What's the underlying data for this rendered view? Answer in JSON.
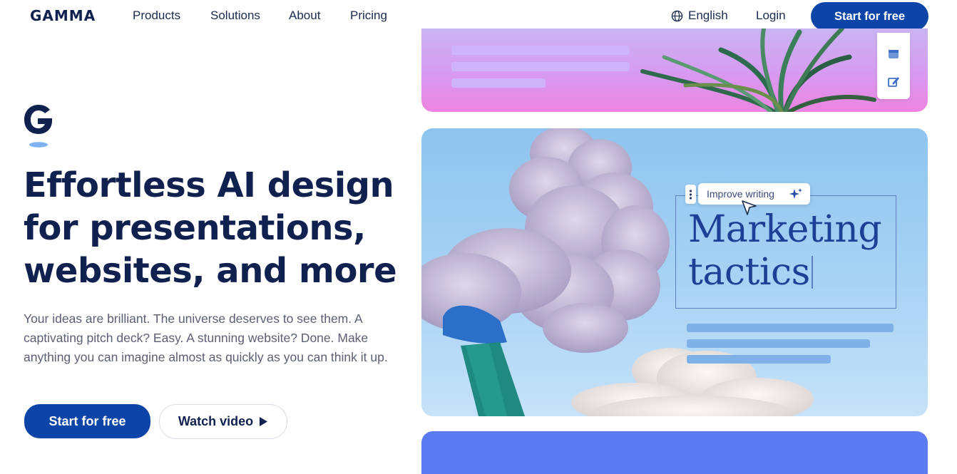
{
  "header": {
    "logo": "GAMMA",
    "nav": [
      "Products",
      "Solutions",
      "About",
      "Pricing"
    ],
    "language": "English",
    "login": "Login",
    "cta": "Start for free"
  },
  "hero": {
    "title_lines": [
      "Effortless AI design",
      "for presentations,",
      "websites, and more"
    ],
    "subtitle": "Your ideas are brilliant. The universe deserves to see them. A captivating pitch deck? Easy. A stunning website? Done. Make anything you can imagine almost as quickly as you can think it up.",
    "primary_cta": "Start for free",
    "secondary_cta": "Watch video"
  },
  "preview": {
    "ai_action": "Improve writing",
    "heading_lines": [
      "Marketing",
      "tactics"
    ]
  },
  "icons": [
    "globe-icon",
    "play-icon",
    "sparkle-icon",
    "cursor-icon",
    "card-layout-icon",
    "edit-icon",
    "drag-handle-icon"
  ],
  "colors": {
    "brand_navy": "#10214f",
    "primary_button": "#0d44a8",
    "card_pink": "#ec84e0",
    "card_blue": "#8ec4ef",
    "card_bottom": "#5a7bf2"
  }
}
